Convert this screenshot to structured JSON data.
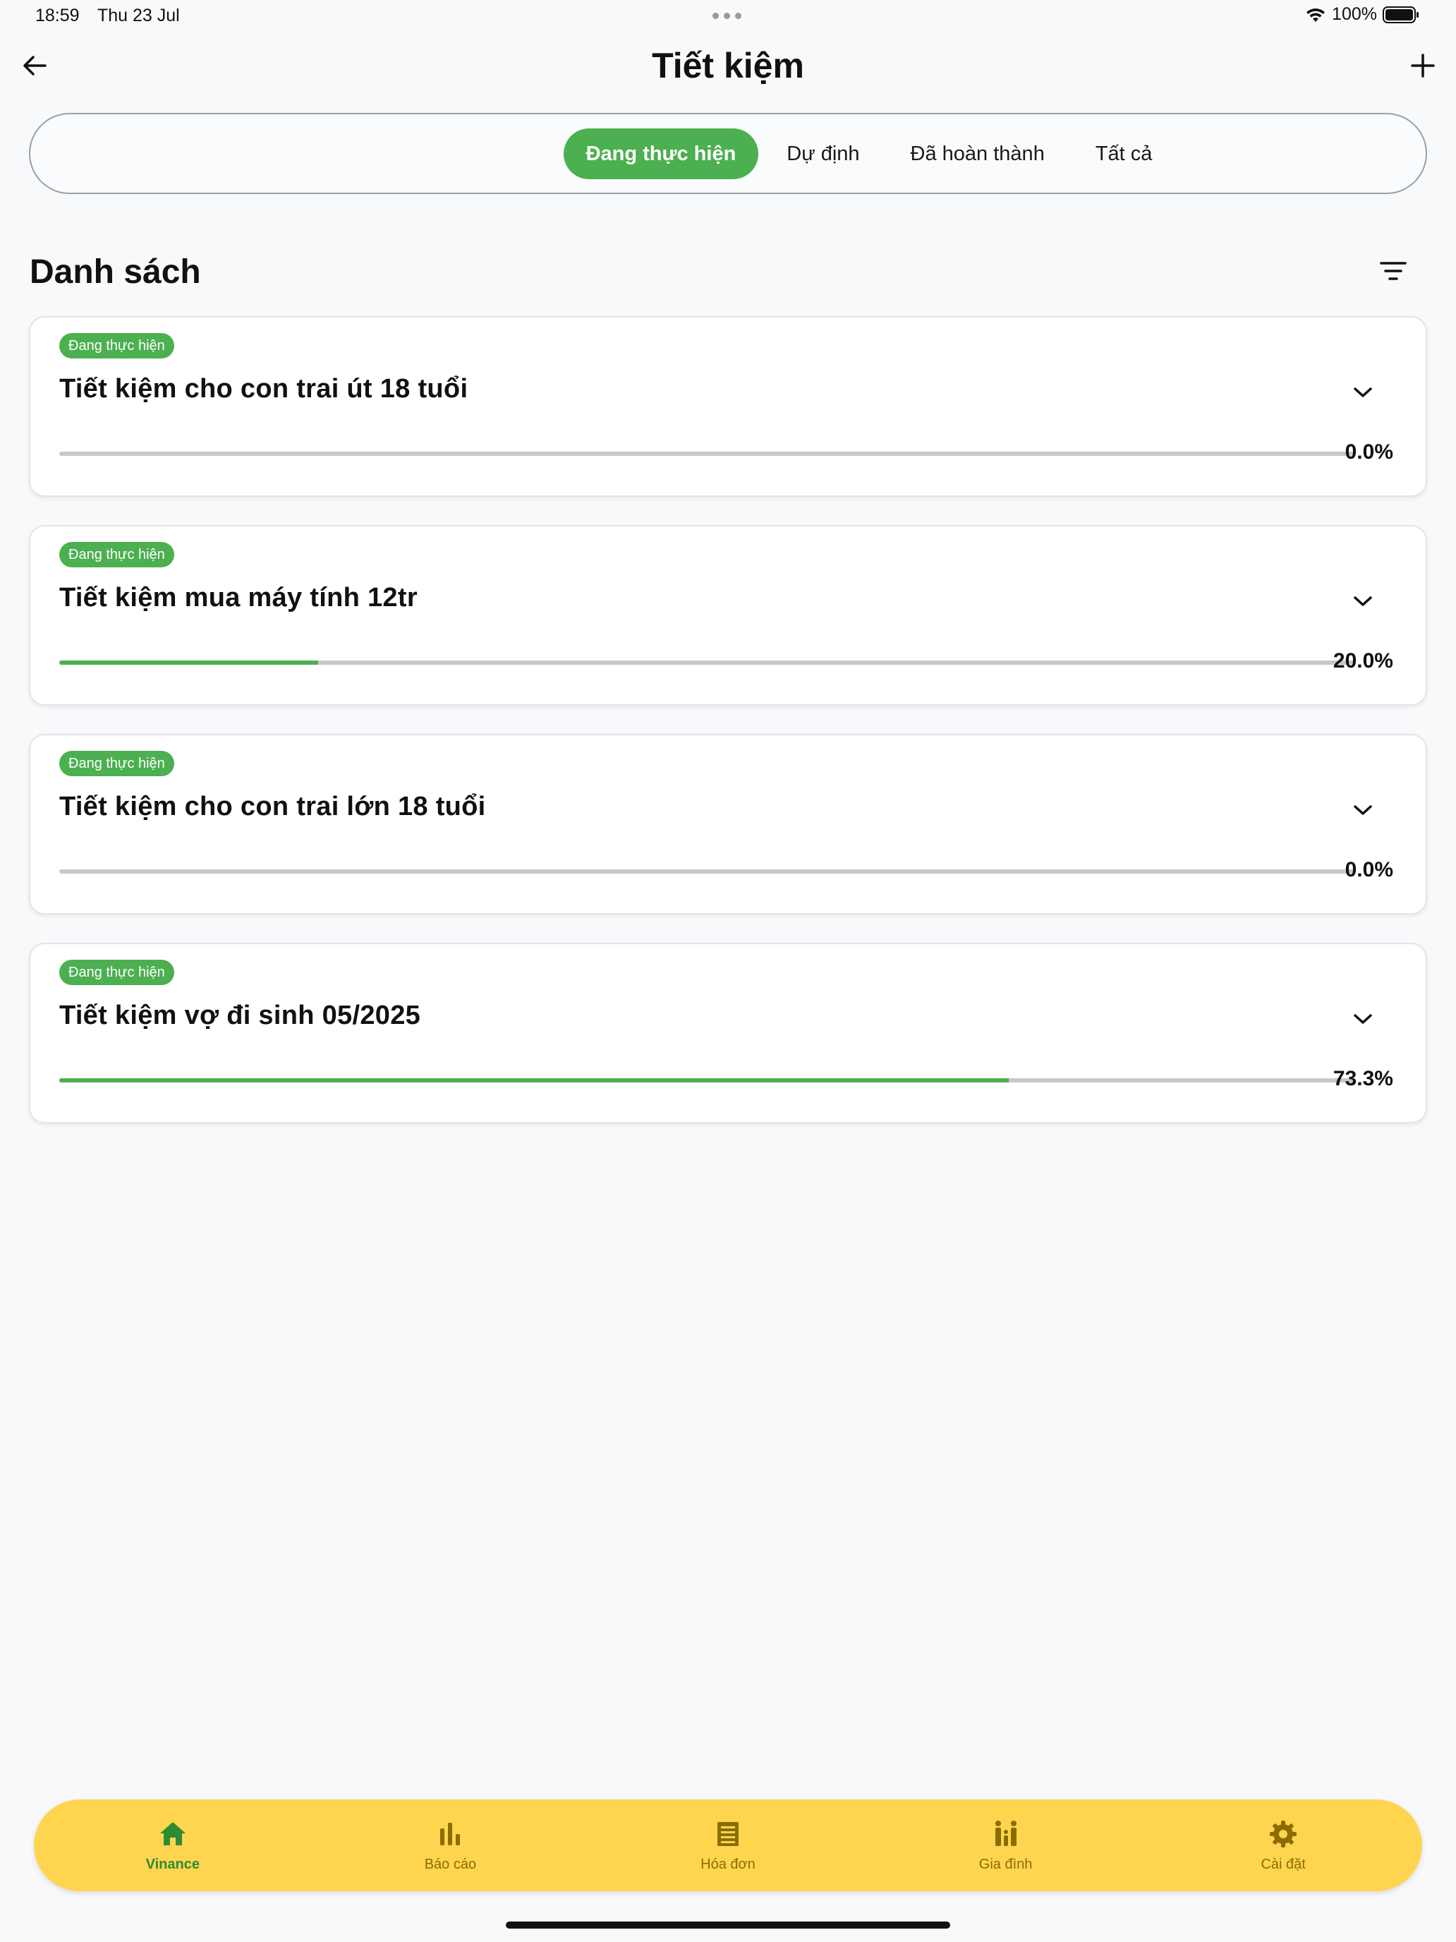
{
  "status_bar": {
    "time": "18:59",
    "date": "Thu 23 Jul",
    "battery": "100%"
  },
  "nav": {
    "title": "Tiết kiệm",
    "back_icon": "arrow-left-icon",
    "add_icon": "plus-icon"
  },
  "tabs": [
    {
      "label": "Đang thực hiện",
      "active": true
    },
    {
      "label": "Dự định",
      "active": false
    },
    {
      "label": "Đã hoàn thành",
      "active": false
    },
    {
      "label": "Tất cả",
      "active": false
    }
  ],
  "section": {
    "title": "Danh sách",
    "filter_icon": "filter-icon"
  },
  "savings": [
    {
      "status": "Đang thực hiện",
      "title": "Tiết kiệm cho con trai út 18 tuổi",
      "progress": 0.0,
      "progress_label": "0.0%"
    },
    {
      "status": "Đang thực hiện",
      "title": "Tiết kiệm mua máy tính 12tr",
      "progress": 20.0,
      "progress_label": "20.0%"
    },
    {
      "status": "Đang thực hiện",
      "title": "Tiết kiệm cho con trai lớn 18 tuổi",
      "progress": 0.0,
      "progress_label": "0.0%"
    },
    {
      "status": "Đang thực hiện",
      "title": "Tiết kiệm vợ đi sinh 05/2025",
      "progress": 73.3,
      "progress_label": "73.3%"
    }
  ],
  "bottom_nav": [
    {
      "label": "Vinance",
      "icon": "home-icon",
      "active": true
    },
    {
      "label": "Báo cáo",
      "icon": "bar-chart-icon",
      "active": false
    },
    {
      "label": "Hóa đơn",
      "icon": "receipt-icon",
      "active": false
    },
    {
      "label": "Gia đình",
      "icon": "family-icon",
      "active": false
    },
    {
      "label": "Cài đặt",
      "icon": "gear-icon",
      "active": false
    }
  ],
  "colors": {
    "accent": "#4caf50",
    "bottom_nav_bg": "#ffd54f",
    "bottom_nav_inactive": "#8a6d00",
    "bottom_nav_active": "#2e8b34"
  }
}
